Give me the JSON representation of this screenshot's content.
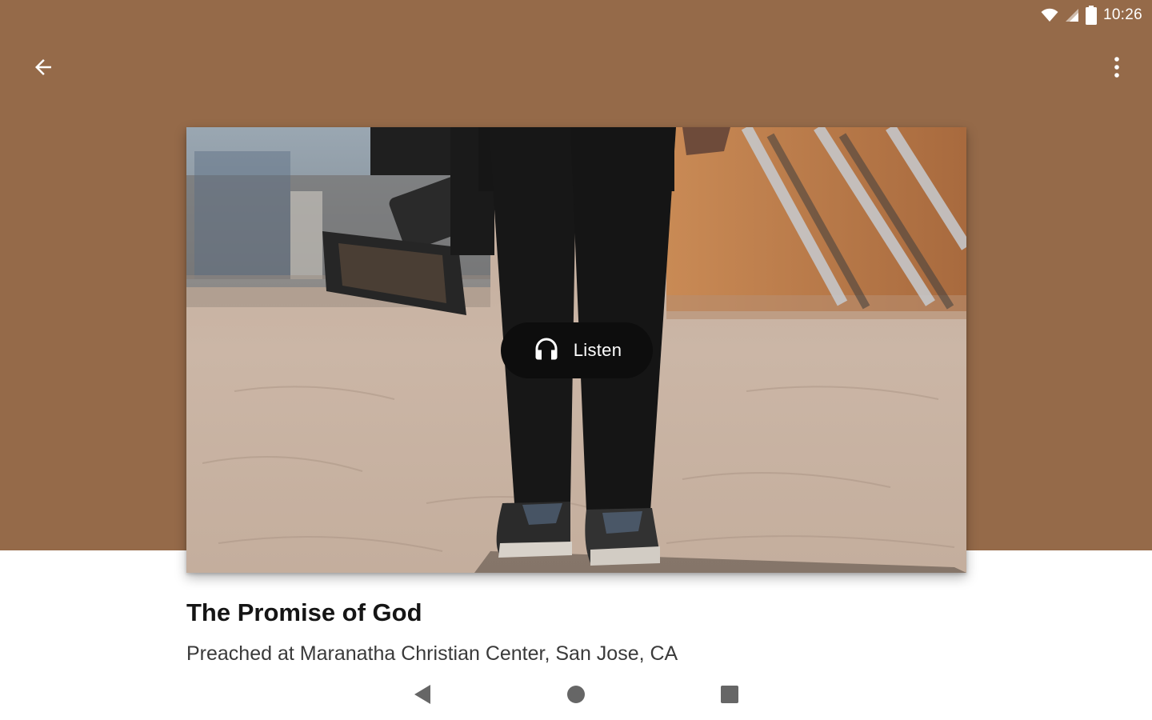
{
  "status_bar": {
    "time": "10:26",
    "icons": [
      "wifi-icon",
      "cell-signal-icon",
      "battery-icon"
    ]
  },
  "toolbar": {
    "back_icon": "arrow-back-icon",
    "overflow_icon": "more-vertical-icon"
  },
  "colors": {
    "hero_background": "#956a49",
    "listen_button": "#0d0d0d",
    "title_text": "#151515",
    "subtitle_text": "#3a3a3a"
  },
  "artwork": {
    "listen_label": "Listen",
    "listen_icon": "headphones-icon"
  },
  "sermon": {
    "title": "The Promise of God",
    "subtitle": "Preached at Maranatha Christian Center, San Jose, CA"
  },
  "nav_bar": {
    "buttons": [
      "back-triangle-icon",
      "home-circle-icon",
      "recents-square-icon"
    ]
  }
}
